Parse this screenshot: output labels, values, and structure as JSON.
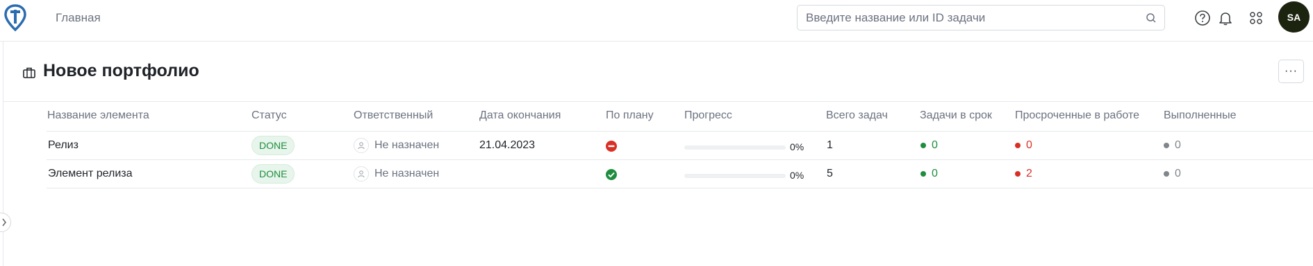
{
  "nav": {
    "home_label": "Главная"
  },
  "search": {
    "placeholder": "Введите название или ID задачи",
    "value": ""
  },
  "user": {
    "initials": "SA"
  },
  "page": {
    "title": "Новое портфолио",
    "more_label": "···"
  },
  "table": {
    "headers": [
      "Название элемента",
      "Статус",
      "Ответственный",
      "Дата окончания",
      "По плану",
      "Прогресс",
      "Всего задач",
      "Задачи в срок",
      "Просроченные в работе",
      "Выполненные"
    ],
    "rows": [
      {
        "name": "Релиз",
        "status": "DONE",
        "assignee": "Не назначен",
        "due_date": "21.04.2023",
        "plan_state": "blocked",
        "progress": 0,
        "progress_label": "0%",
        "total": "1",
        "on_time": "0",
        "overdue": "0",
        "done": "0"
      },
      {
        "name": "Элемент релиза",
        "status": "DONE",
        "assignee": "Не назначен",
        "due_date": "",
        "plan_state": "ok",
        "progress": 0,
        "progress_label": "0%",
        "total": "5",
        "on_time": "0",
        "overdue": "2",
        "done": "0"
      }
    ]
  },
  "colors": {
    "green": "#1e8e3e",
    "red": "#d93025",
    "gray": "#80868b",
    "avatar_bg": "#1c2410",
    "logo": "#2b6cb0"
  }
}
